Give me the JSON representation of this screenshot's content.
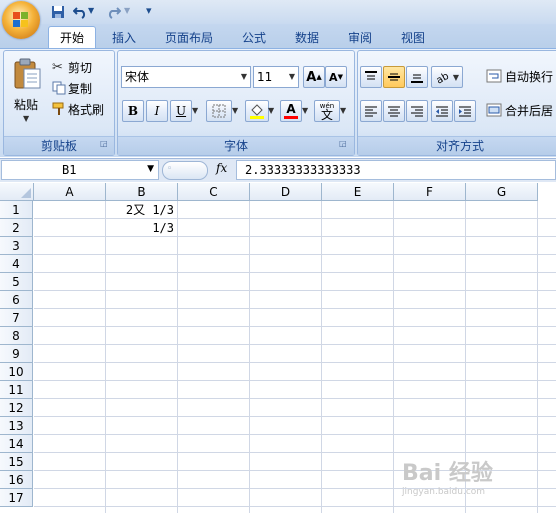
{
  "quick_access": {
    "icons": [
      "save-icon",
      "undo-icon",
      "redo-icon",
      "customize-icon"
    ]
  },
  "tabs": [
    {
      "label": "开始",
      "active": true
    },
    {
      "label": "插入"
    },
    {
      "label": "页面布局"
    },
    {
      "label": "公式"
    },
    {
      "label": "数据"
    },
    {
      "label": "审阅"
    },
    {
      "label": "视图"
    }
  ],
  "clipboard": {
    "paste_label": "粘贴",
    "cut_label": "剪切",
    "copy_label": "复制",
    "format_painter_label": "格式刷",
    "group_title": "剪贴板"
  },
  "font": {
    "font_name": "宋体",
    "font_size": "11",
    "grow_label": "A",
    "shrink_label": "A",
    "bold_label": "B",
    "italic_label": "I",
    "underline_label": "U",
    "font_color_label": "A",
    "phonetic_label": "文",
    "phonetic_small": "wén",
    "group_title": "字体",
    "highlight_color": "#ffff00",
    "font_color": "#ff0000"
  },
  "alignment": {
    "wrap_label": "自动换行",
    "merge_label": "合并后居",
    "group_title": "对齐方式"
  },
  "formula_bar": {
    "name_box": "B1",
    "fx_label": "fx",
    "formula": "2.33333333333333"
  },
  "sheet": {
    "columns": [
      "A",
      "B",
      "C",
      "D",
      "E",
      "F",
      "G"
    ],
    "rows": [
      "1",
      "2",
      "3",
      "4",
      "5",
      "6",
      "7",
      "8",
      "9",
      "10",
      "11",
      "12",
      "13",
      "14",
      "15",
      "16",
      "17"
    ],
    "cells": {
      "B1": "2又 1/3",
      "B2": "1/3"
    }
  },
  "watermark": {
    "text": "Bai 经验",
    "sub": "jingyan.baidu.com"
  }
}
